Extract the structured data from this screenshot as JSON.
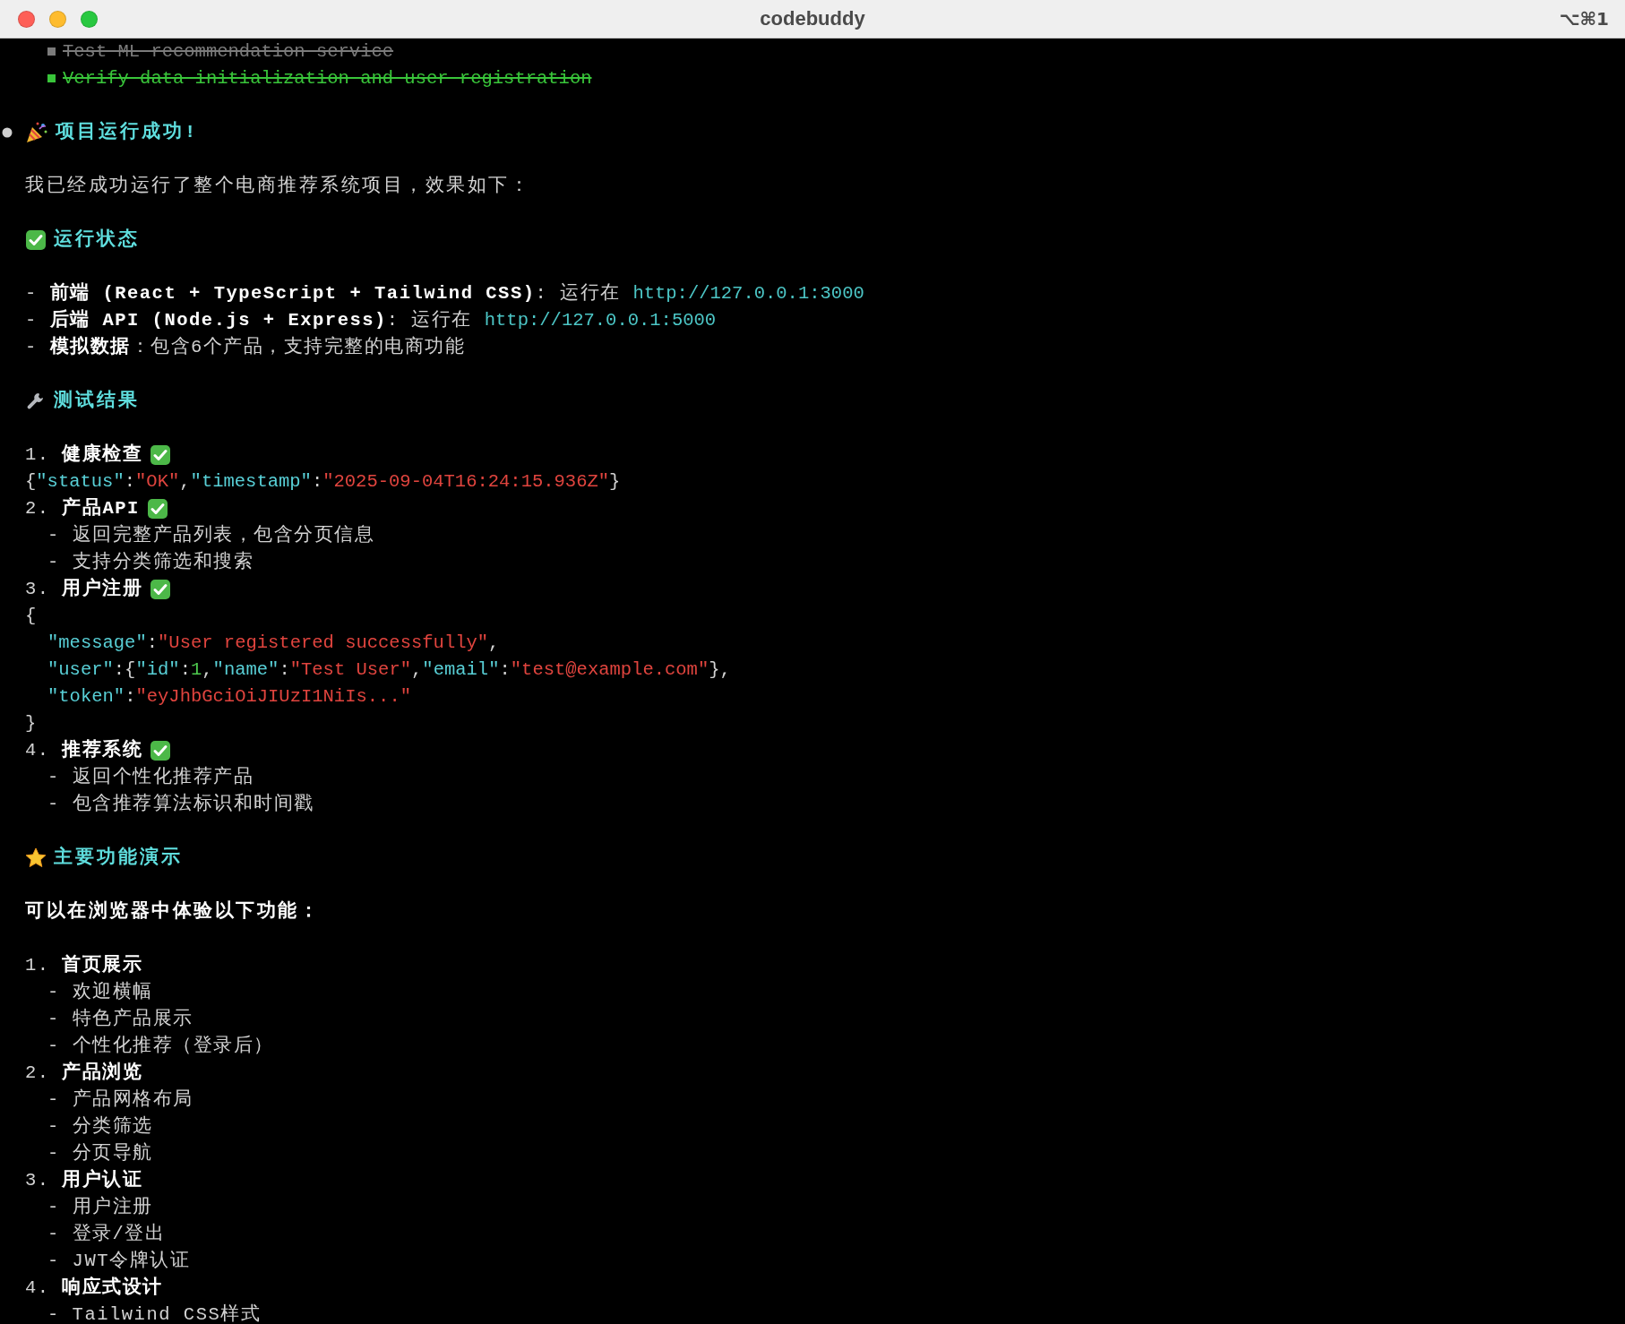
{
  "window": {
    "title": "codebuddy",
    "shortcut": "⌥⌘1"
  },
  "todos": [
    {
      "text": "Test ML recommendation service",
      "done": true,
      "active": false
    },
    {
      "text": "Verify data initialization and user registration",
      "done": true,
      "active": true
    }
  ],
  "message": {
    "title": [
      {
        "kind": "party"
      },
      {
        "kind": "heading",
        "text": "项目运行成功!"
      }
    ],
    "blocks": [
      {
        "lines": [
          {
            "kind": "paragraph",
            "segments": [
              {
                "kind": "plain",
                "text": "我已经成功运行了整个电商推荐系统项目，效果如下："
              }
            ]
          }
        ]
      },
      {
        "lines": [
          {
            "kind": "heading",
            "segments": [
              {
                "kind": "check"
              },
              {
                "kind": "heading",
                "text": "运行状态"
              }
            ]
          }
        ]
      },
      {
        "lines": [
          {
            "kind": "item",
            "marker": "-",
            "segments": [
              {
                "kind": "bold",
                "text": "前端 (React + TypeScript + Tailwind CSS)"
              },
              {
                "kind": "plain",
                "text": ": 运行在 "
              },
              {
                "kind": "link",
                "text": "http://127.0.0.1:3000"
              }
            ]
          },
          {
            "kind": "item",
            "marker": "-",
            "segments": [
              {
                "kind": "bold",
                "text": "后端 API (Node.js + Express)"
              },
              {
                "kind": "plain",
                "text": ": 运行在 "
              },
              {
                "kind": "link",
                "text": "http://127.0.0.1:5000"
              }
            ]
          },
          {
            "kind": "item",
            "marker": "-",
            "segments": [
              {
                "kind": "bold",
                "text": "模拟数据"
              },
              {
                "kind": "plain",
                "text": "：包含6个产品，支持完整的电商功能"
              }
            ]
          }
        ]
      },
      {
        "lines": [
          {
            "kind": "heading",
            "segments": [
              {
                "kind": "wrench"
              },
              {
                "kind": "heading",
                "text": "测试结果"
              }
            ]
          }
        ]
      },
      {
        "lines": [
          {
            "kind": "item",
            "marker": "1.",
            "segments": [
              {
                "kind": "bold",
                "text": "健康检查"
              },
              {
                "kind": "check"
              }
            ]
          },
          {
            "kind": "code",
            "segments": [
              {
                "kind": "plain",
                "text": "{"
              },
              {
                "kind": "key",
                "text": "\"status\""
              },
              {
                "kind": "plain",
                "text": ":"
              },
              {
                "kind": "string",
                "text": "\"OK\""
              },
              {
                "kind": "plain",
                "text": ","
              },
              {
                "kind": "key",
                "text": "\"timestamp\""
              },
              {
                "kind": "plain",
                "text": ":"
              },
              {
                "kind": "string",
                "text": "\"2025-09-04T16:24:15.936Z\""
              },
              {
                "kind": "plain",
                "text": "}"
              }
            ]
          },
          {
            "kind": "item",
            "marker": "2.",
            "segments": [
              {
                "kind": "bold",
                "text": "产品API"
              },
              {
                "kind": "check"
              }
            ],
            "children": [
              {
                "kind": "item",
                "marker": "-",
                "segments": [
                  {
                    "kind": "plain",
                    "text": "返回完整产品列表，包含分页信息"
                  }
                ]
              },
              {
                "kind": "item",
                "marker": "-",
                "segments": [
                  {
                    "kind": "plain",
                    "text": "支持分类筛选和搜索"
                  }
                ]
              }
            ]
          },
          {
            "kind": "item",
            "marker": "3.",
            "segments": [
              {
                "kind": "bold",
                "text": "用户注册"
              },
              {
                "kind": "check"
              }
            ]
          },
          {
            "kind": "code",
            "segments": [
              {
                "kind": "plain",
                "text": "{"
              }
            ],
            "children": [
              {
                "kind": "code",
                "segments": [
                  {
                    "kind": "key",
                    "text": "\"message\""
                  },
                  {
                    "kind": "plain",
                    "text": ":"
                  },
                  {
                    "kind": "string",
                    "text": "\"User registered successfully\""
                  },
                  {
                    "kind": "plain",
                    "text": ","
                  }
                ]
              },
              {
                "kind": "code",
                "segments": [
                  {
                    "kind": "key",
                    "text": "\"user\""
                  },
                  {
                    "kind": "plain",
                    "text": ":{"
                  },
                  {
                    "kind": "key",
                    "text": "\"id\""
                  },
                  {
                    "kind": "plain",
                    "text": ":"
                  },
                  {
                    "kind": "number",
                    "text": "1"
                  },
                  {
                    "kind": "plain",
                    "text": ","
                  },
                  {
                    "kind": "key",
                    "text": "\"name\""
                  },
                  {
                    "kind": "plain",
                    "text": ":"
                  },
                  {
                    "kind": "string",
                    "text": "\"Test User\""
                  },
                  {
                    "kind": "plain",
                    "text": ","
                  },
                  {
                    "kind": "key",
                    "text": "\"email\""
                  },
                  {
                    "kind": "plain",
                    "text": ":"
                  },
                  {
                    "kind": "string",
                    "text": "\"test@example.com\""
                  },
                  {
                    "kind": "plain",
                    "text": "},"
                  }
                ]
              },
              {
                "kind": "code",
                "segments": [
                  {
                    "kind": "key",
                    "text": "\"token\""
                  },
                  {
                    "kind": "plain",
                    "text": ":"
                  },
                  {
                    "kind": "string",
                    "text": "\"eyJhbGciOiJIUzI1NiIs...\""
                  }
                ]
              }
            ]
          },
          {
            "kind": "code",
            "segments": [
              {
                "kind": "plain",
                "text": "}"
              }
            ]
          },
          {
            "kind": "item",
            "marker": "4.",
            "segments": [
              {
                "kind": "bold",
                "text": "推荐系统"
              },
              {
                "kind": "check"
              }
            ],
            "children": [
              {
                "kind": "item",
                "marker": "-",
                "segments": [
                  {
                    "kind": "plain",
                    "text": "返回个性化推荐产品"
                  }
                ]
              },
              {
                "kind": "item",
                "marker": "-",
                "segments": [
                  {
                    "kind": "plain",
                    "text": "包含推荐算法标识和时间戳"
                  }
                ]
              }
            ]
          }
        ]
      },
      {
        "lines": [
          {
            "kind": "heading",
            "segments": [
              {
                "kind": "star"
              },
              {
                "kind": "heading",
                "text": "主要功能演示"
              }
            ]
          }
        ]
      },
      {
        "lines": [
          {
            "kind": "paragraph",
            "segments": [
              {
                "kind": "bold",
                "text": "可以在浏览器中体验以下功能："
              }
            ]
          }
        ]
      },
      {
        "lines": [
          {
            "kind": "item",
            "marker": "1.",
            "segments": [
              {
                "kind": "bold",
                "text": "首页展示"
              }
            ],
            "children": [
              {
                "kind": "item",
                "marker": "-",
                "segments": [
                  {
                    "kind": "plain",
                    "text": "欢迎横幅"
                  }
                ]
              },
              {
                "kind": "item",
                "marker": "-",
                "segments": [
                  {
                    "kind": "plain",
                    "text": "特色产品展示"
                  }
                ]
              },
              {
                "kind": "item",
                "marker": "-",
                "segments": [
                  {
                    "kind": "plain",
                    "text": "个性化推荐（登录后）"
                  }
                ]
              }
            ]
          },
          {
            "kind": "item",
            "marker": "2.",
            "segments": [
              {
                "kind": "bold",
                "text": "产品浏览"
              }
            ],
            "children": [
              {
                "kind": "item",
                "marker": "-",
                "segments": [
                  {
                    "kind": "plain",
                    "text": "产品网格布局"
                  }
                ]
              },
              {
                "kind": "item",
                "marker": "-",
                "segments": [
                  {
                    "kind": "plain",
                    "text": "分类筛选"
                  }
                ]
              },
              {
                "kind": "item",
                "marker": "-",
                "segments": [
                  {
                    "kind": "plain",
                    "text": "分页导航"
                  }
                ]
              }
            ]
          },
          {
            "kind": "item",
            "marker": "3.",
            "segments": [
              {
                "kind": "bold",
                "text": "用户认证"
              }
            ],
            "children": [
              {
                "kind": "item",
                "marker": "-",
                "segments": [
                  {
                    "kind": "plain",
                    "text": "用户注册"
                  }
                ]
              },
              {
                "kind": "item",
                "marker": "-",
                "segments": [
                  {
                    "kind": "plain",
                    "text": "登录/登出"
                  }
                ]
              },
              {
                "kind": "item",
                "marker": "-",
                "segments": [
                  {
                    "kind": "plain",
                    "text": "JWT令牌认证"
                  }
                ]
              }
            ]
          },
          {
            "kind": "item",
            "marker": "4.",
            "segments": [
              {
                "kind": "bold",
                "text": "响应式设计"
              }
            ],
            "children": [
              {
                "kind": "item",
                "marker": "-",
                "segments": [
                  {
                    "kind": "plain",
                    "text": "Tailwind CSS样式"
                  }
                ]
              }
            ]
          }
        ]
      }
    ]
  }
}
